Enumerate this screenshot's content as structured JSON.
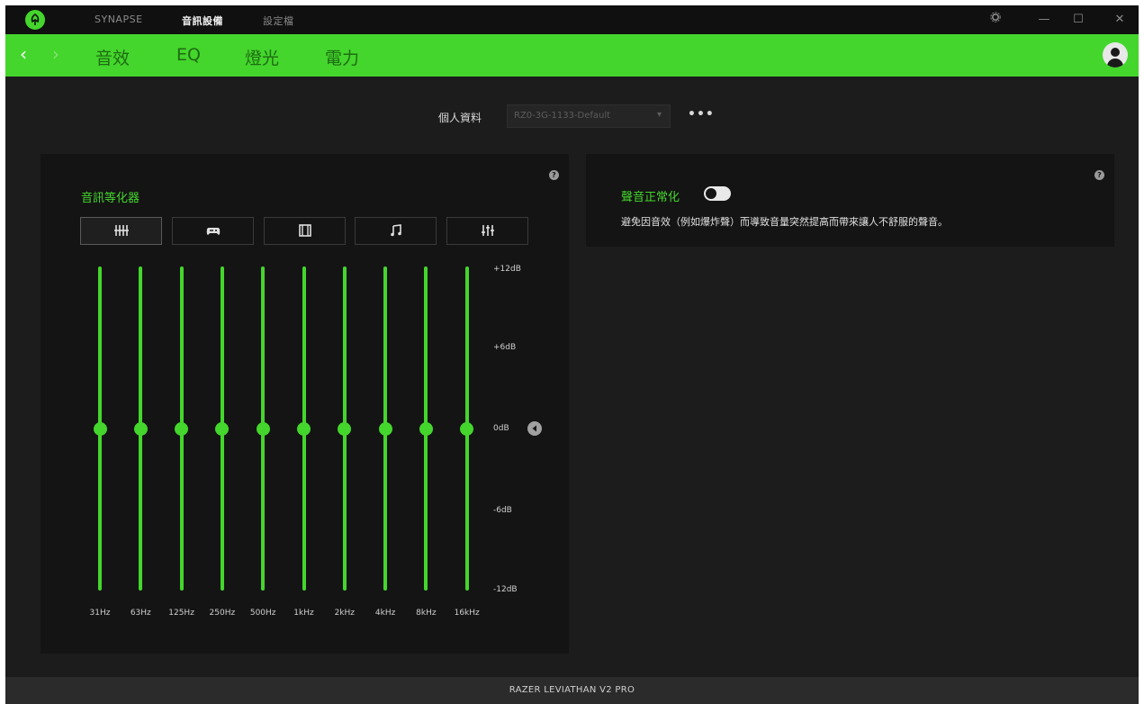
{
  "titlebar": {
    "tabs": [
      {
        "label": "SYNAPSE",
        "active": false
      },
      {
        "label": "音訊設備",
        "active": true
      },
      {
        "label": "設定檔",
        "active": false
      }
    ],
    "controls": {
      "settings_icon": "gear-icon",
      "minimize": "—",
      "maximize": "☐",
      "close": "✕"
    }
  },
  "nav": {
    "back": "‹",
    "forward": "›",
    "tabs": [
      "音效",
      "EQ",
      "燈光",
      "電力"
    ],
    "active_tab": "EQ"
  },
  "profile": {
    "label": "個人資料",
    "value": "RZ0-3G-1133-Default",
    "caret": "▾",
    "more": "•••"
  },
  "equalizer": {
    "title": "音訊等化器",
    "help": "?",
    "presets": [
      "default-eq-icon",
      "game-icon",
      "movie-icon",
      "music-icon",
      "custom-eq-icon"
    ],
    "active_preset": 0,
    "db_scale": [
      "+12dB",
      "+6dB",
      "0dB",
      "-6dB",
      "-12dB"
    ],
    "range_db": [
      -12,
      12
    ],
    "bands": [
      {
        "freq": "31Hz",
        "db": 0
      },
      {
        "freq": "63Hz",
        "db": 0
      },
      {
        "freq": "125Hz",
        "db": 0
      },
      {
        "freq": "250Hz",
        "db": 0
      },
      {
        "freq": "500Hz",
        "db": 0
      },
      {
        "freq": "1kHz",
        "db": 0
      },
      {
        "freq": "2kHz",
        "db": 0
      },
      {
        "freq": "4kHz",
        "db": 0
      },
      {
        "freq": "8kHz",
        "db": 0
      },
      {
        "freq": "16kHz",
        "db": 0
      }
    ],
    "reset_icon": "reset-icon"
  },
  "normalization": {
    "title": "聲音正常化",
    "enabled": false,
    "help": "?",
    "description": "避免因音效（例如爆炸聲）而導致音量突然提高而帶來讓人不舒服的聲音。"
  },
  "footer": {
    "device": "RAZER LEVIATHAN V2 PRO"
  },
  "colors": {
    "accent": "#44d62c",
    "background": "#1c1c1c",
    "panel": "#141414",
    "footer": "#2b2b2b"
  }
}
